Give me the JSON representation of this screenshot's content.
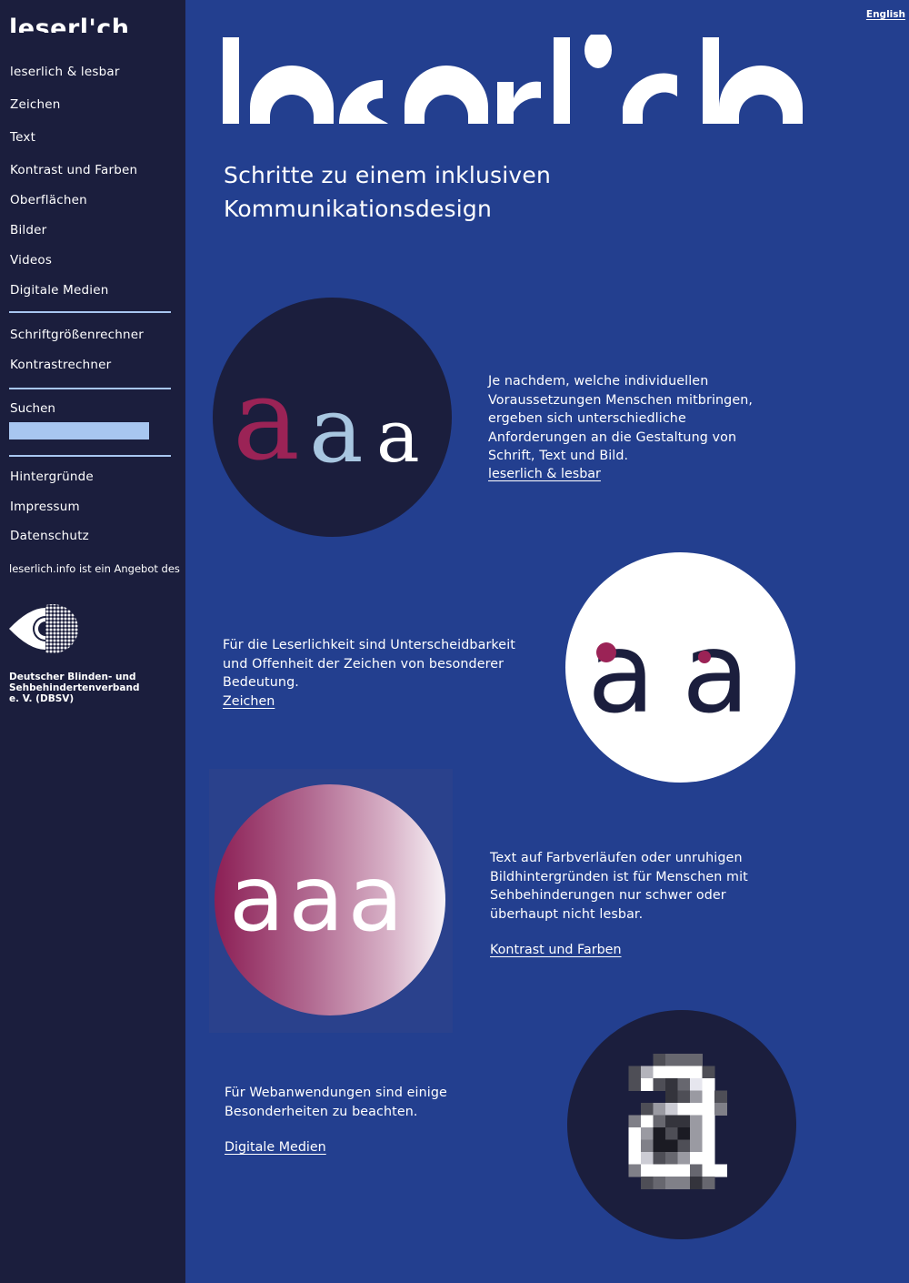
{
  "site": {
    "logo_text": "leserl'ch",
    "language_link": "English"
  },
  "sidebar": {
    "primary_nav": [
      {
        "label": "leserlich & lesbar"
      },
      {
        "label": "Zeichen"
      },
      {
        "label": "Text"
      },
      {
        "label": "Kontrast und Farben"
      },
      {
        "label": "Oberflächen"
      },
      {
        "label": "Bilder"
      },
      {
        "label": "Videos"
      },
      {
        "label": "Digitale Medien"
      }
    ],
    "tools_nav": [
      {
        "label": "Schriftgrößenrechner"
      },
      {
        "label": "Kontrastrechner"
      }
    ],
    "search": {
      "label": "Suchen",
      "value": "",
      "placeholder": ""
    },
    "footer_nav": [
      {
        "label": "Hintergründe"
      },
      {
        "label": "Impressum"
      },
      {
        "label": "Datenschutz"
      }
    ],
    "credit": "leserlich.info ist ein Angebot des",
    "org_name_lines": [
      "Deutscher Blinden- und",
      "Sehbehindertenverband",
      "e. V. (DBSV)"
    ],
    "org_logo_icon": "eye-icon"
  },
  "main": {
    "tagline_lines": [
      "Schritte zu einem inklusiven",
      "Kommunikationsdesign"
    ],
    "sections": [
      {
        "image": "aaa-serif-colored-illustration",
        "glyphs": "aaa",
        "glyph_colors": [
          "#9b2356",
          "#a8c6e0",
          "#ffffff"
        ],
        "text": "Je nachdem, welche individuellen Voraussetzungen Menschen mitbringen, ergeben sich unterschiedliche Anforderungen an die Gestaltung von Schrift, Text und Bild.",
        "link": "leserlich & lesbar"
      },
      {
        "image": "aa-distinguishability-illustration",
        "glyphs": "aa",
        "text": "Für die Leserlichkeit sind Unterscheidbarkeit und Offenheit der Zeichen von besonderer Bedeutung.",
        "link": "Zeichen"
      },
      {
        "image": "aaa-gradient-illustration",
        "glyphs": "aaa",
        "text": "Text auf Farbverläufen oder unruhigen Bildhintergründen ist für Menschen mit Sehbehinderungen nur schwer oder überhaupt nicht lesbar.",
        "link": "Kontrast und Farben"
      },
      {
        "image": "pixelated-a-illustration",
        "glyphs": "a",
        "text": "Für Webanwendungen sind einige Besonderheiten zu beachten.",
        "link": "Digitale Medien"
      }
    ]
  },
  "colors": {
    "sidebar_bg": "#1b1e3d",
    "main_bg": "#233f8f",
    "accent_light_blue": "#a8c6f0",
    "accent_berry": "#9b2356",
    "text": "#ffffff"
  }
}
